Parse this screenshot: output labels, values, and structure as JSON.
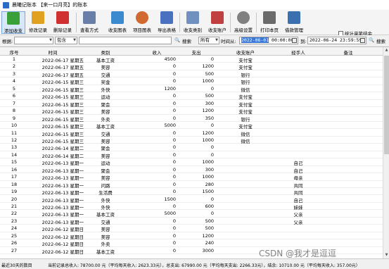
{
  "window": {
    "title": "晨曦记账本 【来一口月亮】的账本"
  },
  "toolbar": {
    "buttons": [
      {
        "label": "添加收支",
        "icon": "add-plus-icon",
        "color": "#3aa03a"
      },
      {
        "label": "修改记录",
        "icon": "edit-record-icon",
        "color": "#e0a020"
      },
      {
        "label": "删除记录",
        "icon": "delete-record-icon",
        "color": "#d03030"
      },
      {
        "label": "查看方式",
        "icon": "view-mode-icon",
        "color": "#6a7fa8"
      },
      {
        "label": "收支图表",
        "icon": "bar-chart-icon",
        "color": "#3a8ad0"
      },
      {
        "label": "项目图表",
        "icon": "pie-chart-icon",
        "color": "#d06a30"
      },
      {
        "label": "导出表格",
        "icon": "export-sheet-icon",
        "color": "#4a70c0"
      },
      {
        "label": "收支类别",
        "icon": "category-icon",
        "color": "#7090c0"
      },
      {
        "label": "收支账户",
        "icon": "account-icon",
        "color": "#c04040"
      },
      {
        "label": "高级设置",
        "icon": "gear-icon",
        "color": "#808080"
      },
      {
        "label": "打印本页",
        "icon": "printer-icon",
        "color": "#6a6a6a"
      },
      {
        "label": "借款管理",
        "icon": "loan-people-icon",
        "color": "#3a70b0"
      }
    ],
    "stats_checkbox_label": "统计单笔结余"
  },
  "filter": {
    "by_label": "根据:",
    "contains_value": "包含",
    "search_label": "搜索",
    "scope_value": "所有",
    "time_from_label": "时间从:",
    "time_from_value_date": "2022-06-01",
    "time_from_value_time": " 00:00:00",
    "to_label": "到:",
    "time_to_value": "2022-06-24 23:59:59",
    "search_button": "搜索"
  },
  "table": {
    "columns": [
      "序号",
      "时间",
      "类别",
      "收入",
      "支出",
      "收支账户",
      "经手人",
      "备注"
    ],
    "rows": [
      [
        "1",
        "2022-06-17 星期五",
        "基本工资",
        "4500",
        "0",
        "支付宝",
        "",
        ""
      ],
      [
        "2",
        "2022-06-17 星期五",
        "美容",
        "0",
        "1200",
        "支付宝",
        "",
        ""
      ],
      [
        "3",
        "2022-06-17 星期五",
        "交通",
        "0",
        "500",
        "银行",
        "",
        ""
      ],
      [
        "4",
        "2022-06-15 星期三",
        "奖金",
        "0",
        "1000",
        "银行",
        "",
        ""
      ],
      [
        "5",
        "2022-06-15 星期三",
        "外快",
        "1200",
        "0",
        "微信",
        "",
        ""
      ],
      [
        "6",
        "2022-06-15 星期三",
        "运动",
        "0",
        "500",
        "支付宝",
        "",
        ""
      ],
      [
        "7",
        "2022-06-15 星期三",
        "聚会",
        "0",
        "300",
        "支付宝",
        "",
        ""
      ],
      [
        "8",
        "2022-06-15 星期三",
        "美容",
        "0",
        "1200",
        "支付宝",
        "",
        ""
      ],
      [
        "9",
        "2022-06-15 星期三",
        "外卖",
        "0",
        "350",
        "银行",
        "",
        ""
      ],
      [
        "10",
        "2022-06-15 星期三",
        "基本工资",
        "5000",
        "0",
        "支付宝",
        "",
        ""
      ],
      [
        "11",
        "2022-06-15 星期三",
        "交通",
        "0",
        "1200",
        "微信",
        "",
        ""
      ],
      [
        "12",
        "2022-06-15 星期三",
        "美容",
        "0",
        "1000",
        "微信",
        "",
        ""
      ],
      [
        "13",
        "2022-06-14 星期二",
        "聚会",
        "0",
        "0",
        "",
        "",
        ""
      ],
      [
        "14",
        "2022-06-14 星期二",
        "美容",
        "0",
        "0",
        "",
        "",
        ""
      ],
      [
        "15",
        "2022-06-13 星期一",
        "运动",
        "0",
        "1000",
        "",
        "自己",
        ""
      ],
      [
        "16",
        "2022-06-13 星期一",
        "聚会",
        "0",
        "300",
        "",
        "自己",
        ""
      ],
      [
        "17",
        "2022-06-13 星期一",
        "美容",
        "0",
        "1000",
        "",
        "母亲",
        ""
      ],
      [
        "18",
        "2022-06-13 星期一",
        "问路",
        "0",
        "280",
        "",
        "共同",
        ""
      ],
      [
        "19",
        "2022-06-13 星期一",
        "生活费",
        "0",
        "1500",
        "",
        "共同",
        ""
      ],
      [
        "20",
        "2022-06-13 星期一",
        "外快",
        "1500",
        "0",
        "",
        "自己",
        ""
      ],
      [
        "21",
        "2022-06-13 星期一",
        "外快",
        "0",
        "600",
        "",
        "妹妹",
        ""
      ],
      [
        "22",
        "2022-06-13 星期一",
        "基本工资",
        "5000",
        "0",
        "",
        "父亲",
        ""
      ],
      [
        "23",
        "2022-06-13 星期一",
        "交通",
        "0",
        "500",
        "",
        "父亲",
        ""
      ],
      [
        "24",
        "2022-06-12 星期日",
        "美容",
        "0",
        "500",
        "",
        "",
        ""
      ],
      [
        "25",
        "2022-06-12 星期日",
        "美容",
        "0",
        "1200",
        "",
        "",
        ""
      ],
      [
        "26",
        "2022-06-12 星期日",
        "外卖",
        "0",
        "240",
        "",
        "",
        ""
      ],
      [
        "27",
        "2022-06-12 星期日",
        "基本工资",
        "0",
        "3000",
        "",
        "",
        ""
      ]
    ]
  },
  "status": {
    "left": "最近30天的数目",
    "middle": "当前记录总收入: 78700.00 元（平均每天收入: 2623.33元），总支出: 67990.00 元（平均每天支出: 2266.33元），结余: 10710.00 元（平均每天收入: 357.00元）"
  },
  "watermark": "CSDN @我才是逗逗",
  "colors": {
    "selection": "#3b78d6",
    "active_button": "#d9e8f8"
  }
}
